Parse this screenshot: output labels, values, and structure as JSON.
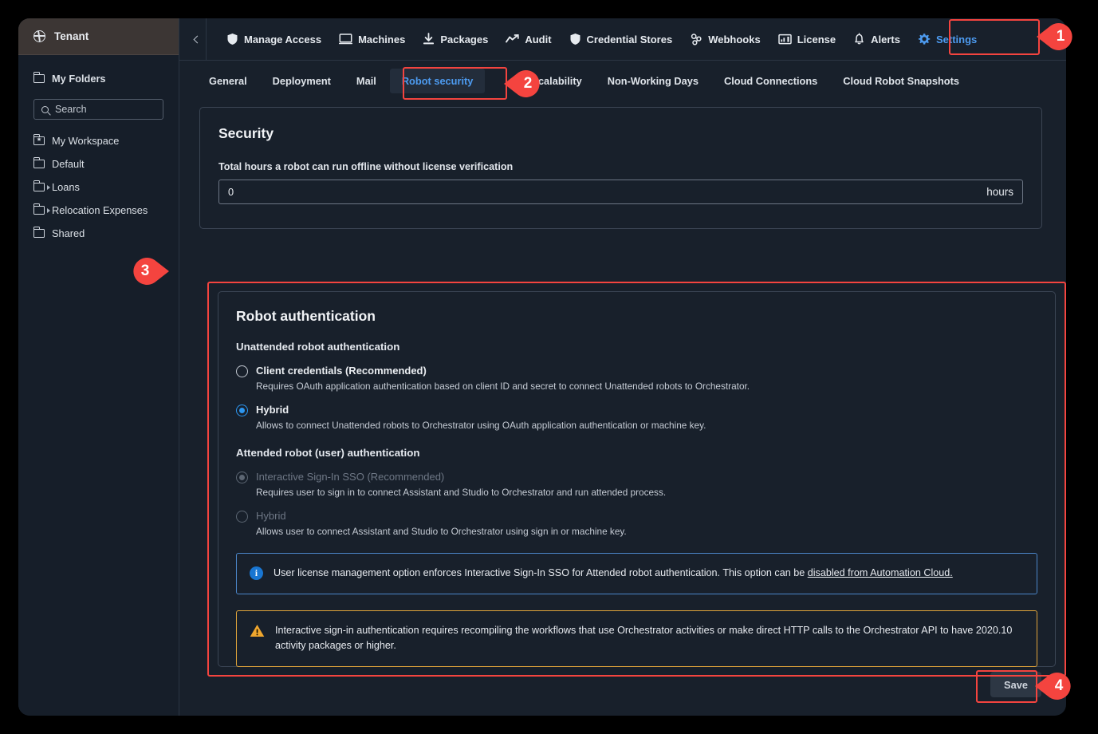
{
  "sidebar": {
    "tenant_label": "Tenant",
    "tenant_icon": "globe-icon",
    "my_folders_label": "My Folders",
    "search_placeholder": "Search",
    "search_value": "",
    "folders": [
      {
        "label": "My Workspace",
        "icon": "folder-star-icon",
        "expandable": false
      },
      {
        "label": "Default",
        "icon": "folder-icon",
        "expandable": false
      },
      {
        "label": "Loans",
        "icon": "folder-icon",
        "expandable": true
      },
      {
        "label": "Relocation Expenses",
        "icon": "folder-icon",
        "expandable": true
      },
      {
        "label": "Shared",
        "icon": "folder-icon",
        "expandable": false
      }
    ]
  },
  "topnav": {
    "collapse_icon": "chevron-left-icon",
    "items": [
      {
        "label": "Manage Access",
        "icon": "shield-icon",
        "active": false
      },
      {
        "label": "Machines",
        "icon": "monitor-icon",
        "active": false
      },
      {
        "label": "Packages",
        "icon": "download-icon",
        "active": false
      },
      {
        "label": "Audit",
        "icon": "trend-line-icon",
        "active": false
      },
      {
        "label": "Credential Stores",
        "icon": "shield-icon",
        "active": false
      },
      {
        "label": "Webhooks",
        "icon": "webhook-icon",
        "active": false
      },
      {
        "label": "License",
        "icon": "license-icon",
        "active": false
      },
      {
        "label": "Alerts",
        "icon": "bell-icon",
        "active": false
      },
      {
        "label": "Settings",
        "icon": "gear-icon",
        "active": true
      }
    ]
  },
  "subtabs": [
    {
      "label": "General",
      "active": false
    },
    {
      "label": "Deployment",
      "active": false
    },
    {
      "label": "Mail",
      "active": false
    },
    {
      "label": "Robot security",
      "active": true
    },
    {
      "label": "Scalability",
      "active": false
    },
    {
      "label": "Non-Working Days",
      "active": false
    },
    {
      "label": "Cloud Connections",
      "active": false
    },
    {
      "label": "Cloud Robot Snapshots",
      "active": false
    }
  ],
  "security_card": {
    "title": "Security",
    "field_label": "Total hours a robot can run offline without license verification",
    "field_value": "0",
    "field_unit": "hours"
  },
  "robot_auth_card": {
    "title": "Robot authentication",
    "unattended_heading": "Unattended robot authentication",
    "unattended_options": [
      {
        "label": "Client credentials (Recommended)",
        "description": "Requires OAuth application authentication based on client ID and secret to connect Unattended robots to Orchestrator.",
        "checked": false,
        "disabled": false
      },
      {
        "label": "Hybrid",
        "description": "Allows to connect Unattended robots to Orchestrator using OAuth application authentication or machine key.",
        "checked": true,
        "disabled": false
      }
    ],
    "attended_heading": "Attended robot (user) authentication",
    "attended_options": [
      {
        "label": "Interactive Sign-In SSO (Recommended)",
        "description": "Requires user to sign in to connect Assistant and Studio to Orchestrator and run attended process.",
        "checked": true,
        "disabled": true
      },
      {
        "label": "Hybrid",
        "description": "Allows user to connect Assistant and Studio to Orchestrator using sign in or machine key.",
        "checked": false,
        "disabled": true
      }
    ],
    "info_banner": {
      "icon": "info-icon",
      "text": "User license management option enforces Interactive Sign-In SSO for Attended robot authentication. This option can be ",
      "link_text": "disabled from Automation Cloud."
    },
    "warning_banner": {
      "icon": "warning-icon",
      "text": "Interactive sign-in authentication requires recompiling the workflows that use Orchestrator activities or make direct HTTP calls to the Orchestrator API to have 2020.10 activity packages or higher."
    }
  },
  "footer": {
    "save_label": "Save"
  },
  "annotations": {
    "accent_color": "#f4443f",
    "badges": [
      {
        "number": "1",
        "target": "settings-nav-item"
      },
      {
        "number": "2",
        "target": "robot-security-tab"
      },
      {
        "number": "3",
        "target": "robot-authentication-section"
      },
      {
        "number": "4",
        "target": "save-button"
      }
    ]
  }
}
